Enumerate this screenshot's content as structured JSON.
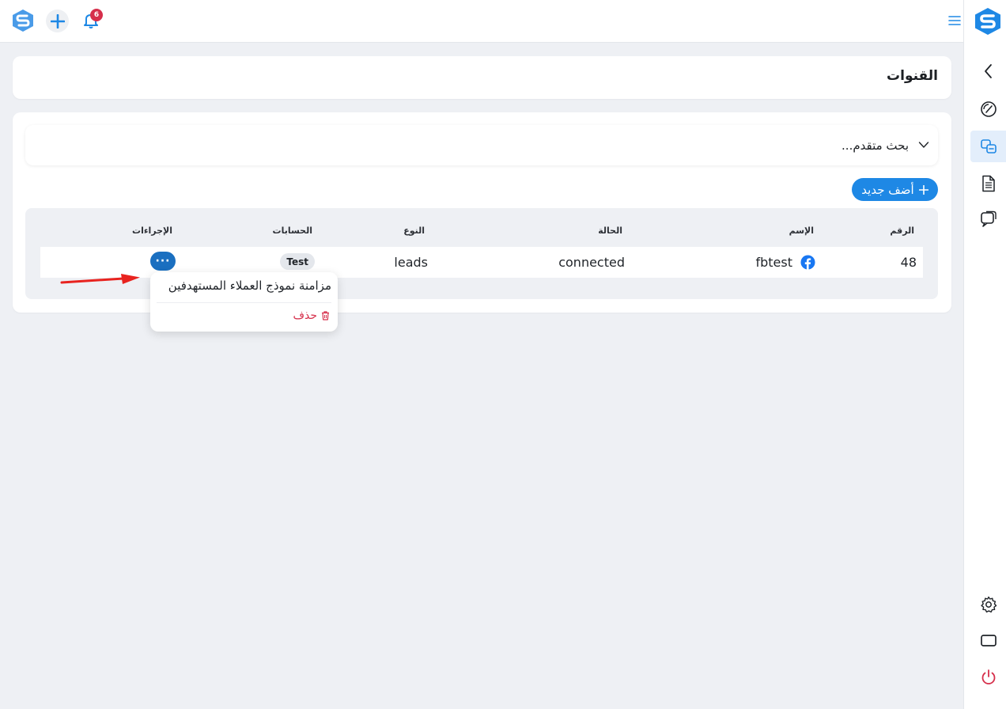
{
  "topbar": {
    "notification_count": "6",
    "icons": [
      "app-logo-icon",
      "add-icon",
      "bell-icon",
      "menu-icon"
    ]
  },
  "sidebar": {
    "items": [
      {
        "name": "collapse",
        "icon": "chevron-left-icon"
      },
      {
        "name": "dashboard",
        "icon": "gauge-icon"
      },
      {
        "name": "channels",
        "icon": "channels-icon",
        "active": true
      },
      {
        "name": "documents",
        "icon": "document-icon"
      },
      {
        "name": "chat",
        "icon": "chat-icon"
      },
      {
        "name": "settings",
        "icon": "gear-icon"
      },
      {
        "name": "screen",
        "icon": "monitor-icon"
      },
      {
        "name": "logout",
        "icon": "power-icon"
      }
    ],
    "active_color": "#1e88e5",
    "logout_color": "#d62f4b"
  },
  "page": {
    "title": "القنوات"
  },
  "search": {
    "label": "بحث متقدم..."
  },
  "add_button": {
    "label": "أضف جديد"
  },
  "table": {
    "headers": {
      "number": "الرقم",
      "name": "الإسم",
      "status": "الحالة",
      "type": "النوع",
      "accounts": "الحسابات",
      "actions": "الإجراءات"
    },
    "rows": [
      {
        "number": "48",
        "name": "fbtest",
        "channel_icon": "facebook-icon",
        "status": "connected",
        "type": "leads",
        "account": "Test",
        "actions_label": "···"
      }
    ]
  },
  "actions_menu": {
    "items": [
      {
        "label": "مزامنة نموذج العملاء المستهدفين"
      },
      {
        "label": "حذف",
        "icon": "trash-icon",
        "color": "#d62f4b"
      }
    ]
  },
  "colors": {
    "primary": "#1e88e5",
    "page_bg": "#eef0f4",
    "danger": "#d62f4b"
  }
}
